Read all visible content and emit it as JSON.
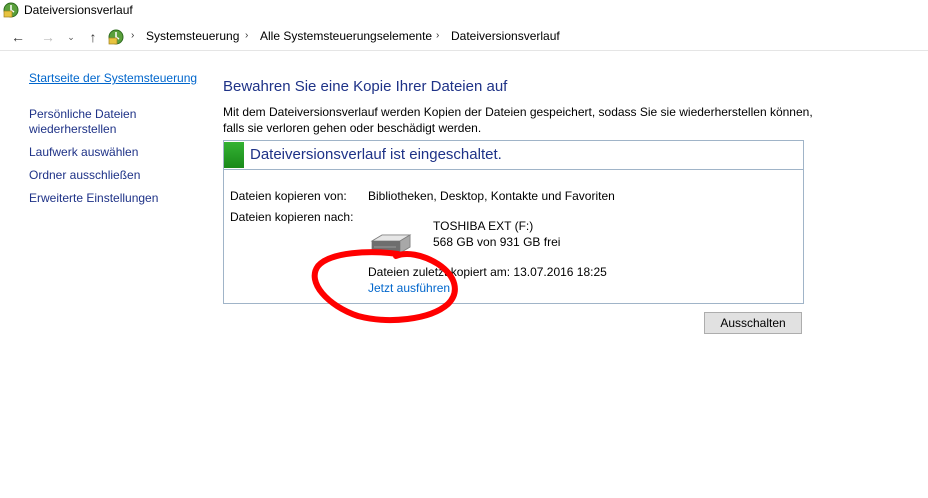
{
  "window": {
    "title": "Dateiversionsverlauf",
    "icon": "file-history-icon"
  },
  "address_bar": {
    "breadcrumbs": [
      "Systemsteuerung",
      "Alle Systemsteuerungselemente",
      "Dateiversionsverlauf"
    ],
    "back_icon": "arrow-left-icon",
    "forward_icon": "arrow-right-icon",
    "recent_icon": "chevron-down-icon",
    "up_icon": "arrow-up-icon"
  },
  "sidebar": {
    "home": "Startseite der Systemsteuerung",
    "items": [
      {
        "label_line1": "Persönliche Dateien",
        "label_line2": "wiederherstellen"
      },
      {
        "label_line1": "Laufwerk auswählen"
      },
      {
        "label_line1": "Ordner ausschließen"
      },
      {
        "label_line1": "Erweiterte Einstellungen"
      }
    ]
  },
  "main": {
    "heading": "Bewahren Sie eine Kopie Ihrer Dateien auf",
    "intro_line1": "Mit dem Dateiversionsverlauf werden Kopien der Dateien gespeichert, sodass Sie sie wiederherstellen können,",
    "intro_line2": "falls sie verloren gehen oder beschädigt werden.",
    "status": {
      "text": "Dateiversionsverlauf ist eingeschaltet.",
      "color": "#2aa12a"
    },
    "copy_from_label": "Dateien kopieren von:",
    "copy_from_value": "Bibliotheken, Desktop, Kontakte und Favoriten",
    "copy_to_label": "Dateien kopieren nach:",
    "drive": {
      "name": "TOSHIBA EXT (F:)",
      "free": "568 GB von 931 GB frei",
      "icon": "drive-icon"
    },
    "last_copied": "Dateien zuletzt kopiert am: 13.07.2016 18:25",
    "run_now": "Jetzt ausführen",
    "turn_off_button": "Ausschalten"
  },
  "colors": {
    "link": "#0066cc",
    "heading": "#1e3287",
    "panel_border": "#a0b4c8",
    "annotation": "#ff0000"
  }
}
